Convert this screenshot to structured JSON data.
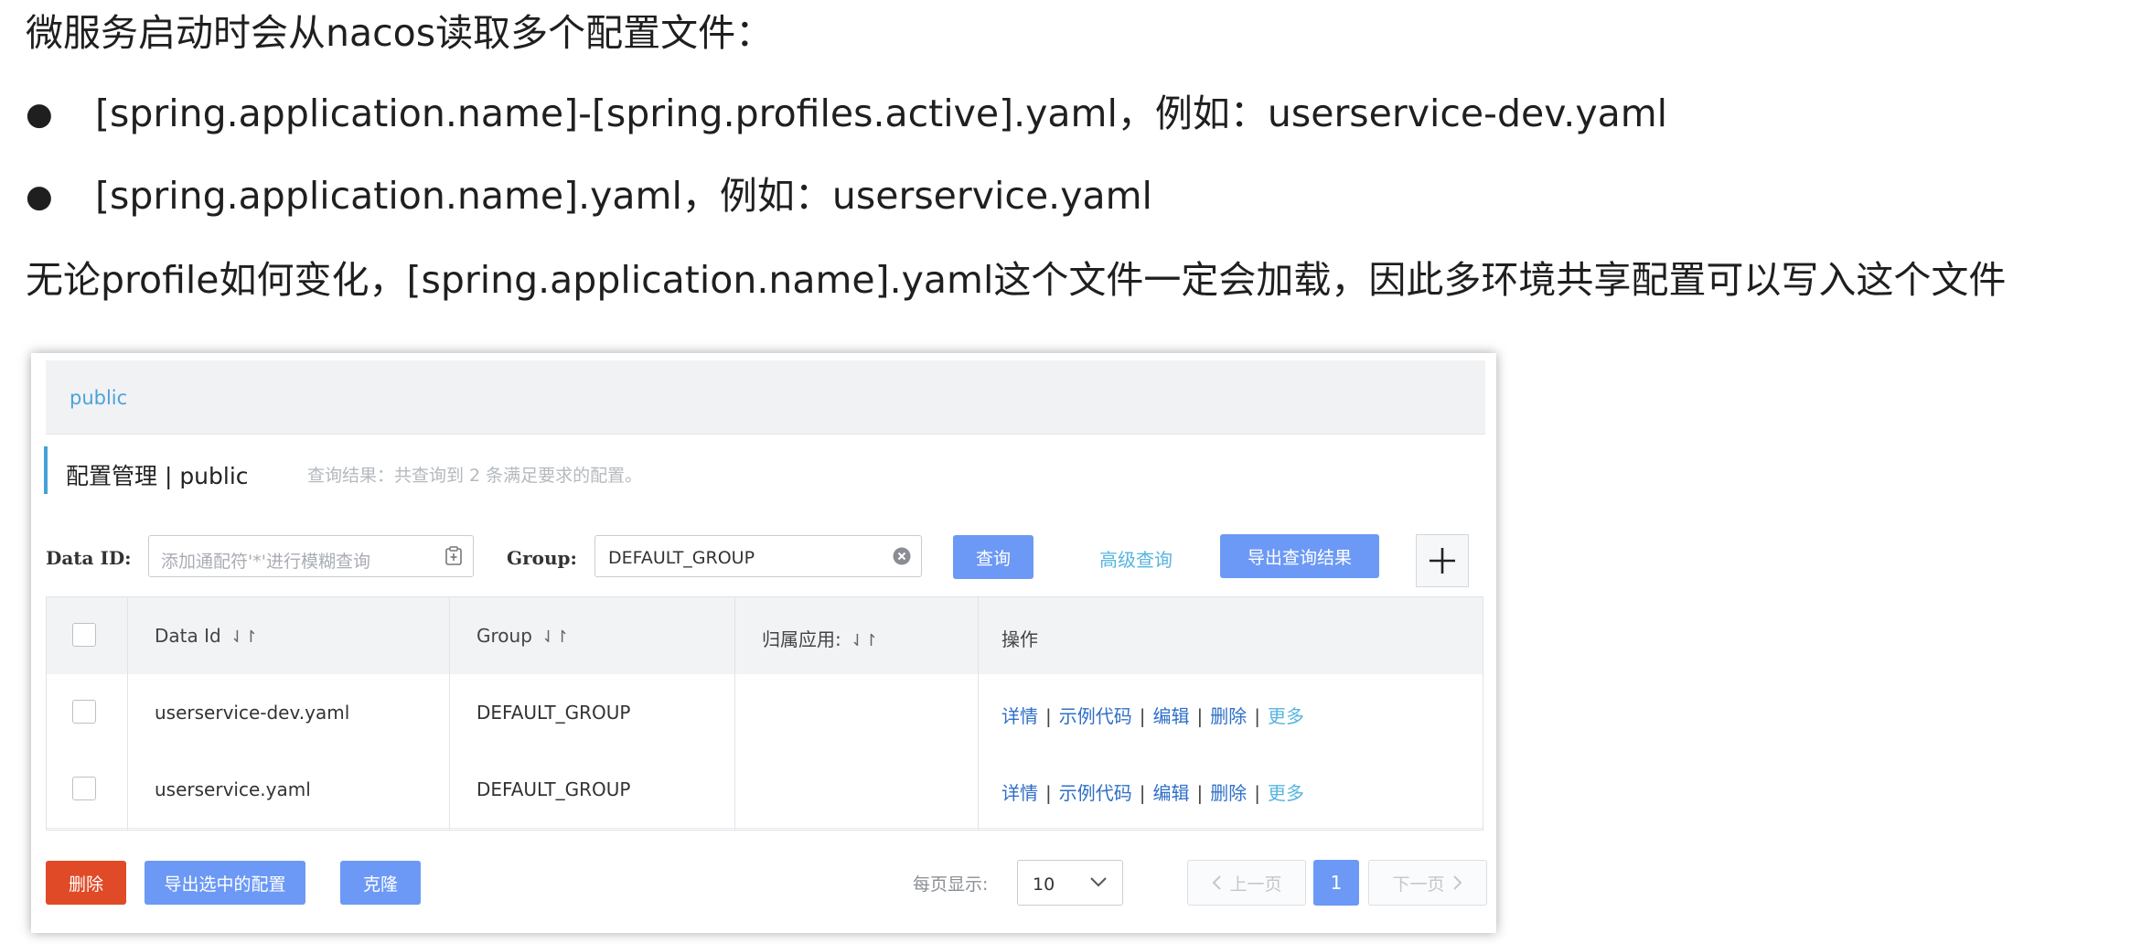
{
  "slide": {
    "intro": "微服务启动时会从nacos读取多个配置文件：",
    "bullets": [
      "[spring.application.name]-[spring.profiles.active].yaml，例如：userservice-dev.yaml",
      "[spring.application.name].yaml，例如：userservice.yaml"
    ],
    "conclusion": "无论profile如何变化，[spring.application.name].yaml这个文件一定会加载，因此多环境共享配置可以写入这个文件"
  },
  "namespace_bar": {
    "label": "public"
  },
  "page_title": {
    "text": "配置管理 | public",
    "hint": "查询结果：共查询到 2 条满足要求的配置。"
  },
  "search": {
    "data_id_label": "Data ID:",
    "data_id_placeholder": "添加通配符'*'进行模糊查询",
    "group_label": "Group:",
    "group_value": "DEFAULT_GROUP",
    "query_button": "查询",
    "advanced_query": "高级查询",
    "export_button": "导出查询结果",
    "add_button": "+"
  },
  "table": {
    "headers": [
      "Data Id",
      "Group",
      "归属应用:",
      "操作"
    ],
    "sort_glyph": "⇃↾",
    "rows": [
      {
        "data_id": "userservice-dev.yaml",
        "group": "DEFAULT_GROUP",
        "app": ""
      },
      {
        "data_id": "userservice.yaml",
        "group": "DEFAULT_GROUP",
        "app": ""
      }
    ],
    "actions": [
      "详情",
      "示例代码",
      "编辑",
      "删除",
      "更多"
    ],
    "action_sep": "|"
  },
  "footer": {
    "delete_button": "删除",
    "export_selected_button": "导出选中的配置",
    "clone_button": "克隆",
    "page_size_label": "每页显示:",
    "page_size": "10",
    "prev": "上一页",
    "current_page": "1",
    "next": "下一页"
  },
  "colors": {
    "primary": "#6c99f5",
    "danger": "#e04a26",
    "link": "#2f6fc8",
    "accent": "#56b5e0"
  }
}
